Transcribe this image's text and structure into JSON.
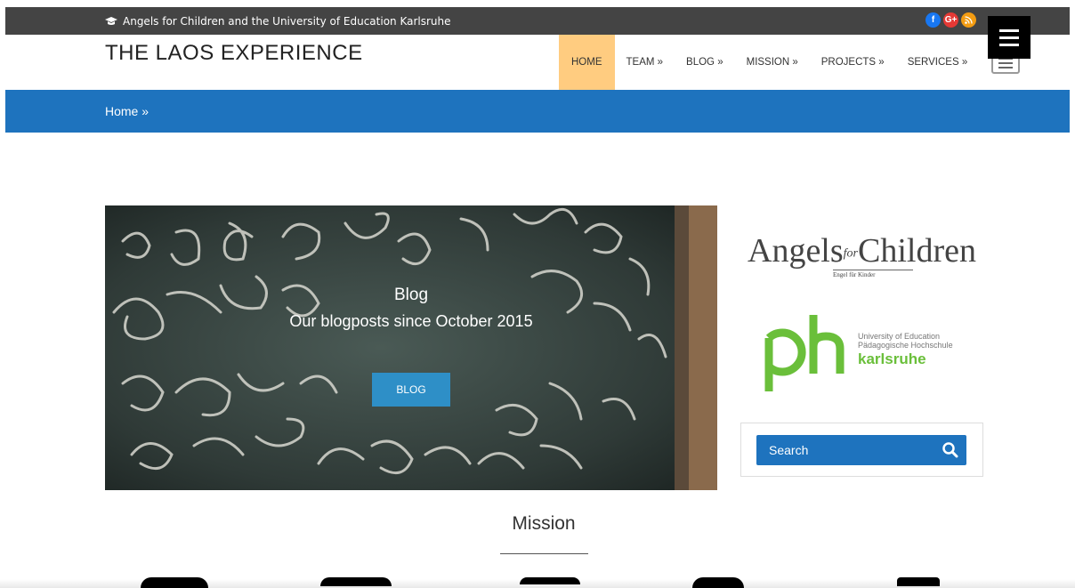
{
  "topbar": {
    "tagline": "Angels for Children and the University of Education Karlsruhe",
    "social": {
      "facebook": "f",
      "googleplus": "G+",
      "rss": ")"
    },
    "colors": {
      "bar": "#444444",
      "facebook": "#1877f2",
      "googleplus": "#e53935",
      "rss": "#f39c12"
    }
  },
  "header": {
    "site_title": "THE LAOS EXPERIENCE",
    "nav": [
      "HOME",
      "TEAM »",
      "BLOG »",
      "MISSION »",
      "PROJECTS »",
      "SERVICES »"
    ],
    "active_nav": "HOME",
    "active_color": "#ffcc80"
  },
  "breadcrumb": {
    "text": "Home »",
    "color": "#1e73be"
  },
  "hero": {
    "title": "Blog",
    "subtitle": "Our blogposts since October 2015",
    "button_label": "BLOG",
    "button_color": "#2e8fc7"
  },
  "sidebar": {
    "angels": {
      "name_left": "Angels",
      "for": "for",
      "name_right": "Children",
      "sub": "Engel für Kinder"
    },
    "ph": {
      "mark": "ph",
      "line1": "University of Education",
      "line2": "Pädagogische Hochschule",
      "city": "karlsruhe",
      "color": "#6abf3a"
    },
    "search": {
      "placeholder": "Search"
    }
  },
  "mission": {
    "title": "Mission"
  }
}
